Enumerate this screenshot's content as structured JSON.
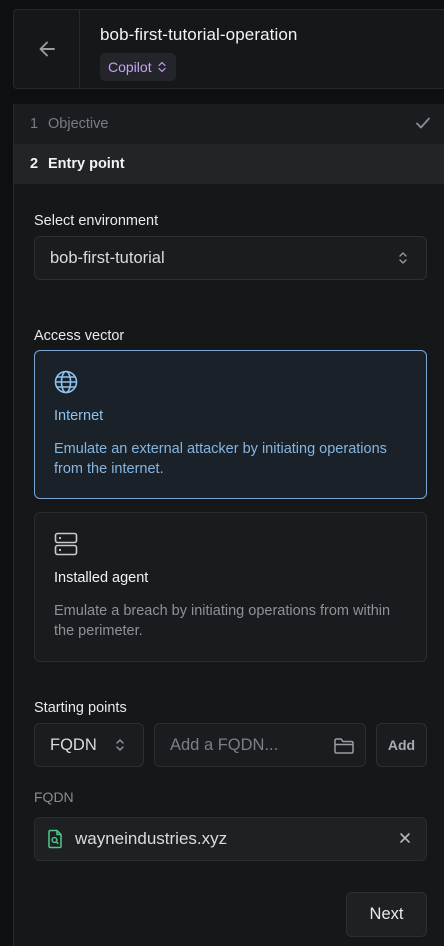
{
  "header": {
    "title": "bob-first-tutorial-operation",
    "badge": "Copilot"
  },
  "steps": [
    {
      "number": "1",
      "label": "Objective",
      "status": "complete"
    },
    {
      "number": "2",
      "label": "Entry point",
      "status": "active"
    }
  ],
  "environment": {
    "label": "Select environment",
    "value": "bob-first-tutorial"
  },
  "access_vector": {
    "label": "Access vector",
    "options": [
      {
        "icon": "globe-icon",
        "title": "Internet",
        "description": "Emulate an external attacker by initiating operations from the internet.",
        "selected": true
      },
      {
        "icon": "server-icon",
        "title": "Installed agent",
        "description": "Emulate a breach by initiating operations from within the perimeter.",
        "selected": false
      }
    ]
  },
  "starting_points": {
    "label": "Starting points",
    "type_value": "FQDN",
    "input_placeholder": "Add a FQDN...",
    "add_label": "Add",
    "list_label": "FQDN",
    "items": [
      "wayneindustries.xyz"
    ]
  },
  "footer": {
    "next_label": "Next"
  },
  "colors": {
    "accent_blue": "#7aa7d6",
    "badge_purple": "#c7a2f5",
    "file_green": "#4ec98a"
  }
}
